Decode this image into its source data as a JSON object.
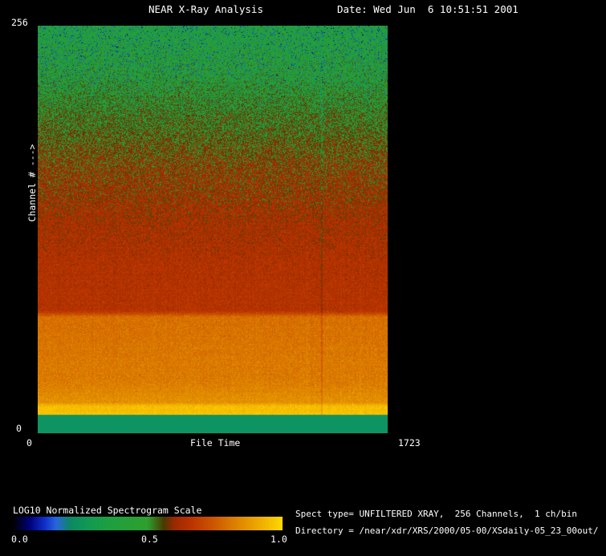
{
  "window": {
    "background": "#000000",
    "text_color": "#ffffff"
  },
  "header": {
    "title": "NEAR X-Ray Analysis",
    "date_label": "Date: Wed Jun  6 10:51:51 2001"
  },
  "plot": {
    "y_axis": {
      "max_label": "256",
      "min_label": "0",
      "title": "Channel # --->"
    },
    "x_axis": {
      "min_label": "0",
      "title": "File Time",
      "max_label": "1723"
    }
  },
  "colorbar": {
    "title": "LOG10 Normalized Spectrogram Scale",
    "ticks": [
      "0.0",
      "0.5",
      "1.0"
    ]
  },
  "info": {
    "spect_type": "Spect type= UNFILTERED XRAY,  256 Channels,  1 ch/bin",
    "directory": "Directory = /near/xdr/XRS/2000/05-00/XSdaily-05_23_00out/"
  },
  "chart_data": {
    "type": "heatmap",
    "title": "NEAR X-Ray Analysis",
    "xlabel": "File Time",
    "ylabel": "Channel # --->",
    "x_range": [
      0,
      1723
    ],
    "y_range": [
      0,
      256
    ],
    "value_scale_label": "LOG10 Normalized Spectrogram Scale",
    "colorbar_range": [
      0.0,
      1.0
    ],
    "colormap_stops": [
      [
        0.0,
        "#000005"
      ],
      [
        0.06,
        "#000078"
      ],
      [
        0.12,
        "#1133cc"
      ],
      [
        0.16,
        "#2a66dd"
      ],
      [
        0.21,
        "#0c8866"
      ],
      [
        0.27,
        "#0f9a55"
      ],
      [
        0.36,
        "#1fa040"
      ],
      [
        0.5,
        "#2f9f30"
      ],
      [
        0.56,
        "#4a3a00"
      ],
      [
        0.6,
        "#9c2a00"
      ],
      [
        0.66,
        "#bb3300"
      ],
      [
        0.74,
        "#cc5500"
      ],
      [
        0.84,
        "#e08800"
      ],
      [
        0.93,
        "#f2b300"
      ],
      [
        1.0,
        "#ffd900"
      ]
    ],
    "profile": [
      {
        "f": 0.0,
        "base": 0.42,
        "up": 0.1,
        "down": 0.42
      },
      {
        "f": 0.12,
        "base": 0.46,
        "up": 0.12,
        "down": 0.4
      },
      {
        "f": 0.24,
        "base": 0.53,
        "up": 0.13,
        "down": 0.32
      },
      {
        "f": 0.36,
        "base": 0.61,
        "up": 0.07,
        "down": 0.22
      },
      {
        "f": 0.48,
        "base": 0.635,
        "up": 0.05,
        "down": 0.12
      },
      {
        "f": 0.6,
        "base": 0.65,
        "up": 0.05,
        "down": 0.08
      },
      {
        "f": 0.7,
        "base": 0.655,
        "up": 0.05,
        "down": 0.07
      },
      {
        "f": 0.715,
        "base": 0.79,
        "up": 0.06,
        "down": 0.06
      },
      {
        "f": 0.88,
        "base": 0.82,
        "up": 0.06,
        "down": 0.06
      },
      {
        "f": 0.925,
        "base": 0.86,
        "up": 0.06,
        "down": 0.05
      },
      {
        "f": 0.935,
        "base": 0.95,
        "up": 0.04,
        "down": 0.05
      },
      {
        "f": 0.956,
        "base": 0.96,
        "up": 0.03,
        "down": 0.04
      }
    ],
    "bottom_band": {
      "y_frac_start": 0.956,
      "color": "#0E9462"
    },
    "column_noise": 0.015,
    "row_noise": 0.012,
    "column_artifact": {
      "x_frac": 0.81,
      "delta": 0.05
    }
  }
}
